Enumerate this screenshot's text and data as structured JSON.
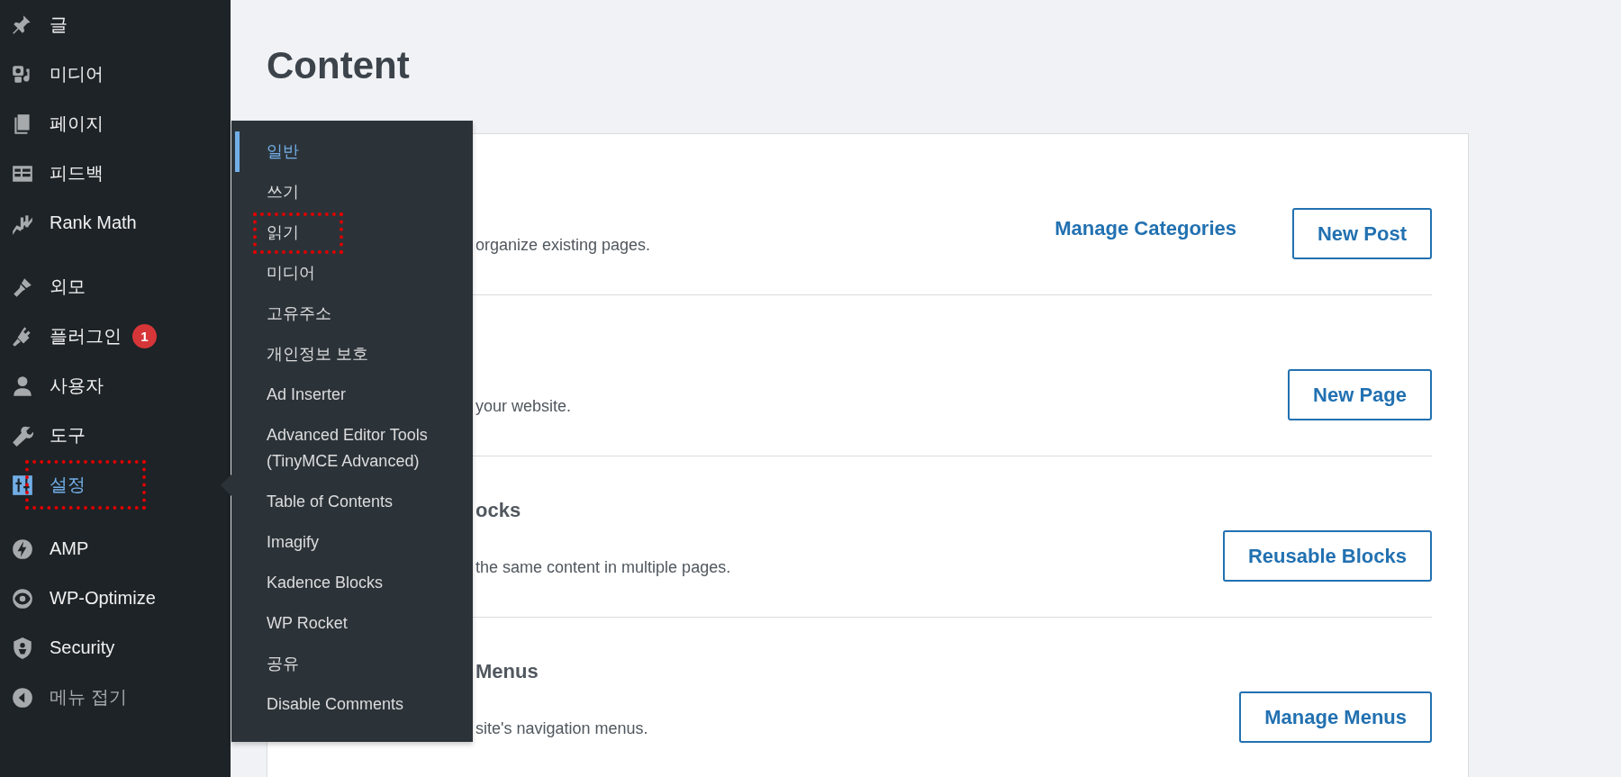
{
  "sidebar": {
    "groups": [
      [
        {
          "label": "글",
          "selected": false,
          "annotated": false
        },
        {
          "label": "미디어",
          "selected": false,
          "annotated": false
        },
        {
          "label": "페이지",
          "selected": false,
          "annotated": false
        },
        {
          "label": "피드백",
          "selected": false,
          "annotated": false
        },
        {
          "label": "Rank Math",
          "selected": false,
          "annotated": false
        }
      ],
      [
        {
          "label": "외모",
          "selected": false,
          "annotated": false
        },
        {
          "label": "플러그인",
          "selected": false,
          "annotated": false,
          "badge": "1"
        },
        {
          "label": "사용자",
          "selected": false,
          "annotated": false
        },
        {
          "label": "도구",
          "selected": false,
          "annotated": false
        },
        {
          "label": "설정",
          "selected": true,
          "annotated": true
        }
      ],
      [
        {
          "label": "AMP",
          "selected": false,
          "annotated": false
        },
        {
          "label": "WP-Optimize",
          "selected": false,
          "annotated": false
        },
        {
          "label": "Security",
          "selected": false,
          "annotated": false
        },
        {
          "label": "메뉴 접기",
          "selected": false,
          "annotated": false,
          "kind": "collapse"
        }
      ]
    ]
  },
  "submenu": {
    "items": [
      {
        "label": "일반",
        "selected": true,
        "annotated": false
      },
      {
        "label": "쓰기",
        "selected": false,
        "annotated": false
      },
      {
        "label": "읽기",
        "selected": false,
        "annotated": true
      },
      {
        "label": "미디어",
        "selected": false,
        "annotated": false
      },
      {
        "label": "고유주소",
        "selected": false,
        "annotated": false
      },
      {
        "label": "개인정보 보호",
        "selected": false,
        "annotated": false
      },
      {
        "label": "Ad Inserter",
        "selected": false,
        "annotated": false
      },
      {
        "label": "Advanced Editor Tools (TinyMCE Advanced)",
        "selected": false,
        "annotated": false
      },
      {
        "label": "Table of Contents",
        "selected": false,
        "annotated": false
      },
      {
        "label": "Imagify",
        "selected": false,
        "annotated": false
      },
      {
        "label": "Kadence Blocks",
        "selected": false,
        "annotated": false
      },
      {
        "label": "WP Rocket",
        "selected": false,
        "annotated": false
      },
      {
        "label": "공유",
        "selected": false,
        "annotated": false
      },
      {
        "label": "Disable Comments",
        "selected": false,
        "annotated": false
      }
    ]
  },
  "page": {
    "title": "Content"
  },
  "card": {
    "rows": [
      {
        "description": "organize existing pages.",
        "link": "Manage Categories",
        "button": "New Post"
      },
      {
        "description": "your website.",
        "button": "New Page"
      },
      {
        "heading": "ocks",
        "description": "the same content in multiple pages.",
        "button": "Reusable Blocks"
      },
      {
        "heading": "Menus",
        "description": "site's navigation menus.",
        "button": "Manage Menus"
      }
    ]
  }
}
